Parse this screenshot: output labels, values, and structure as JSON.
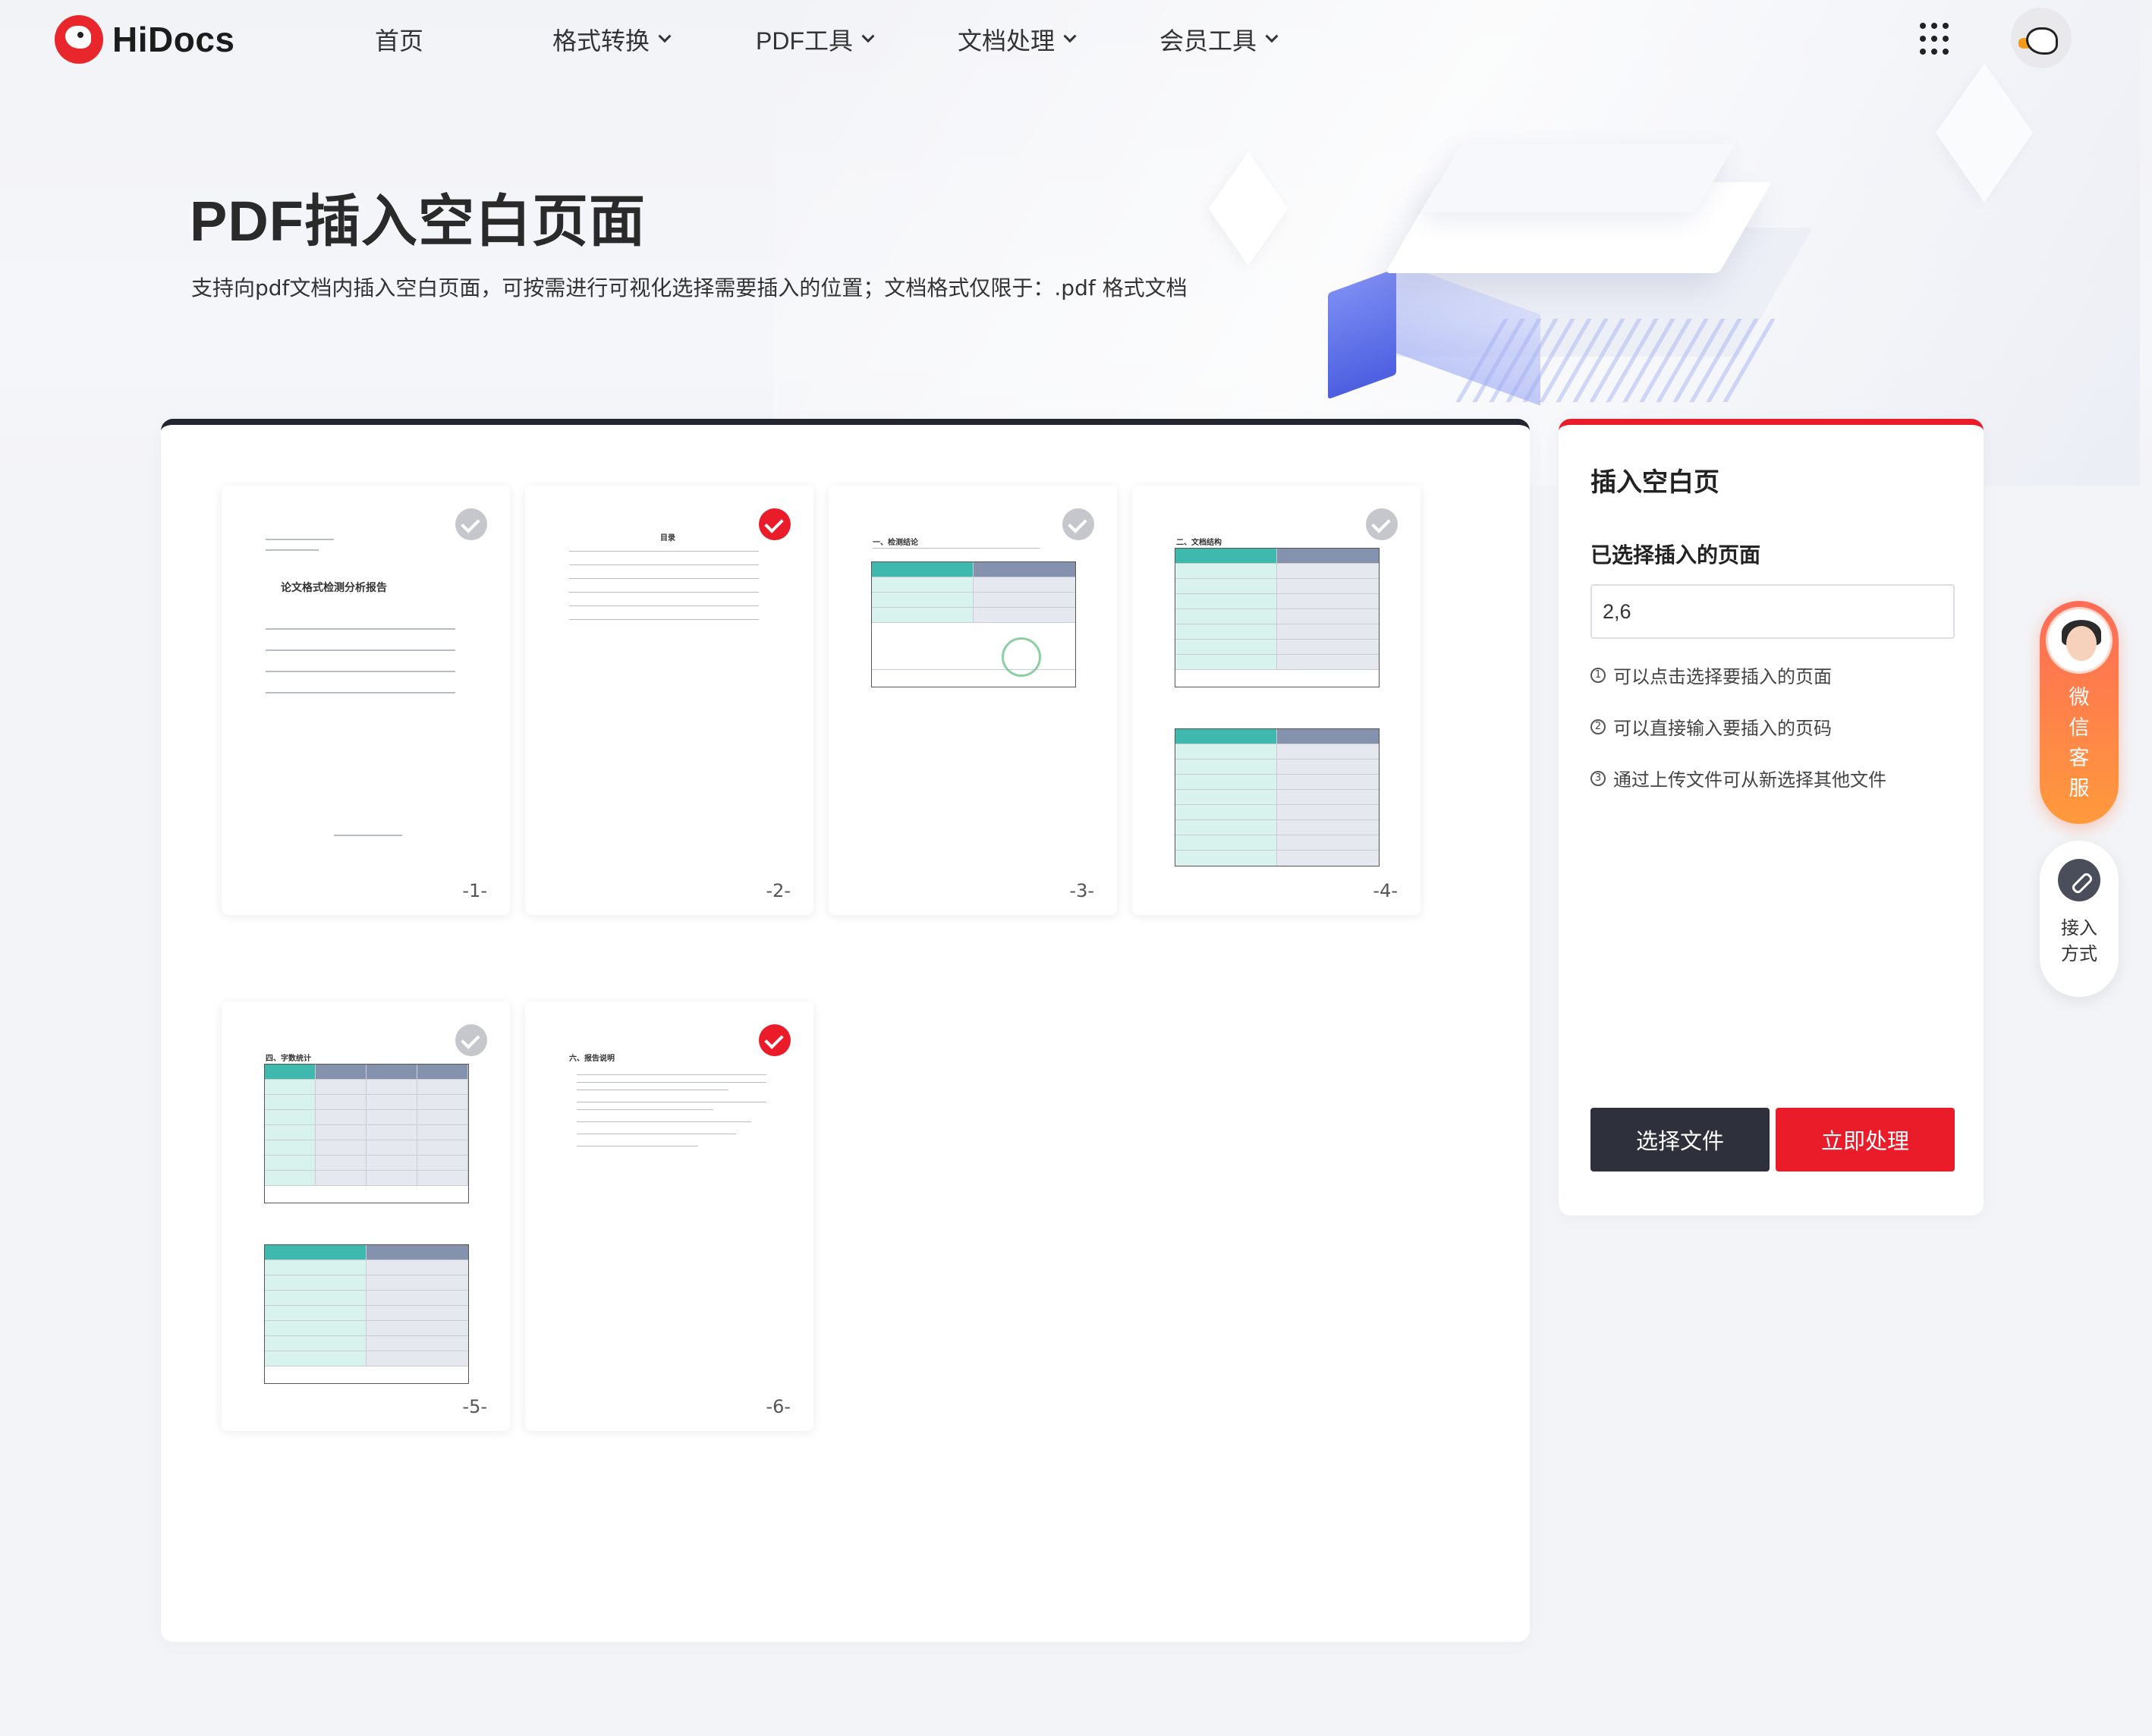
{
  "brand": {
    "name": "HiDocs"
  },
  "nav": {
    "items": [
      {
        "label": "首页",
        "has_dropdown": false
      },
      {
        "label": "格式转换",
        "has_dropdown": true
      },
      {
        "label": "PDF工具",
        "has_dropdown": true
      },
      {
        "label": "文档处理",
        "has_dropdown": true
      },
      {
        "label": "会员工具",
        "has_dropdown": true
      }
    ],
    "apps_icon": "grid-dots-icon",
    "avatar_icon": "bird-avatar-icon"
  },
  "hero": {
    "title": "PDF插入空白页面",
    "subtitle": "支持向pdf文档内插入空白页面，可按需进行可视化选择需要插入的位置；文档格式仅限于：.pdf 格式文档"
  },
  "pages": [
    {
      "number": "-1-",
      "selected": false,
      "title": "论文格式检测分析报告"
    },
    {
      "number": "-2-",
      "selected": true,
      "title": "目录"
    },
    {
      "number": "-3-",
      "selected": false,
      "title": "一、检测结论"
    },
    {
      "number": "-4-",
      "selected": false,
      "title": "二、文档结构"
    },
    {
      "number": "-5-",
      "selected": false,
      "title": "四、字数统计"
    },
    {
      "number": "-6-",
      "selected": true,
      "title": "六、报告说明"
    }
  ],
  "side_panel": {
    "title": "插入空白页",
    "selected_label": "已选择插入的页面",
    "selected_value": "2,6",
    "hints": [
      {
        "num": "1",
        "text": "可以点击选择要插入的页面"
      },
      {
        "num": "2",
        "text": "可以直接输入要插入的页码"
      },
      {
        "num": "3",
        "text": "通过上传文件可从新选择其他文件"
      }
    ],
    "choose_file_label": "选择文件",
    "process_label": "立即处理"
  },
  "floating": {
    "customer_service_label": "微\n信\n客\n服",
    "access_label": "接入\n方式"
  },
  "colors": {
    "accent": "#ea1c29",
    "dark": "#2e313b",
    "teal": "#3fb8ae"
  }
}
